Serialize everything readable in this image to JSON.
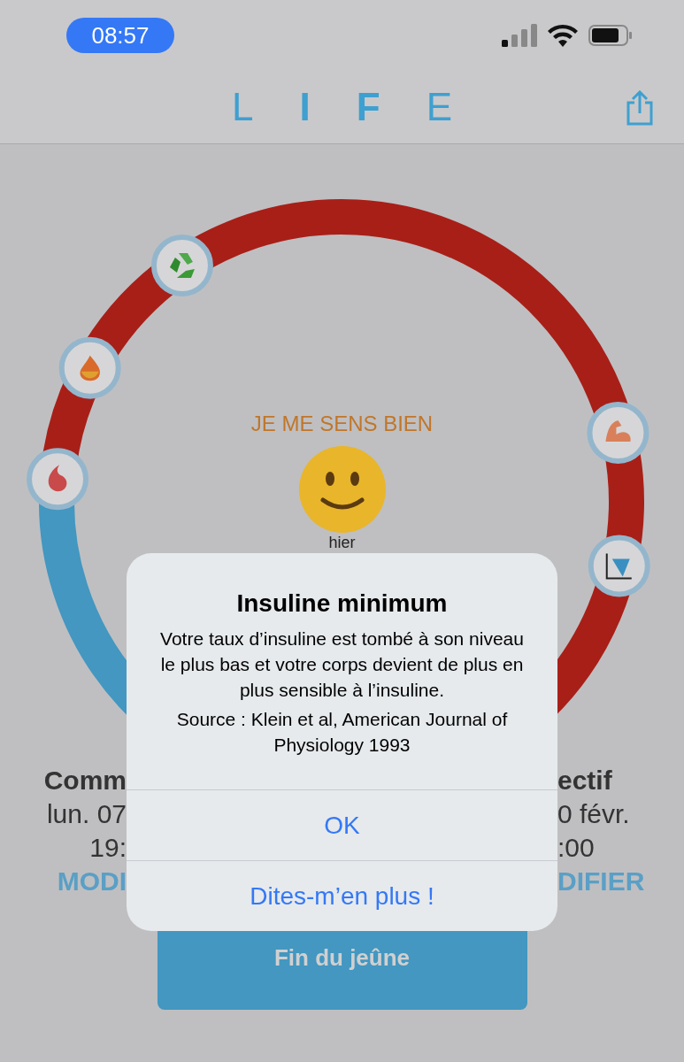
{
  "status_bar": {
    "time": "08:57"
  },
  "header": {
    "logo_letters": [
      {
        "text": "L",
        "bold": false
      },
      {
        "text": "I",
        "bold": true
      },
      {
        "text": "F",
        "bold": true
      },
      {
        "text": "E",
        "bold": false
      }
    ]
  },
  "ring": {
    "mood": "JE ME SENS BIEN",
    "mood_time": "hier"
  },
  "start": {
    "lines": [
      "Comm",
      "lun. 07",
      "19:"
    ],
    "action": "MODI"
  },
  "goal": {
    "lines": [
      "ectif",
      "0 févr.",
      ":00"
    ],
    "action": "DIFIER"
  },
  "end_button": "Fin du jeûne",
  "alert": {
    "title": "Insuline minimum",
    "message": [
      "Votre taux d’insuline est tombé à son niveau le plus bas et votre corps devient de plus en plus sensible à l’insuline.",
      "Source : Klein et al, American Journal of Physiology 1993"
    ],
    "buttons": [
      "OK",
      "Dites-m’en plus !"
    ]
  }
}
